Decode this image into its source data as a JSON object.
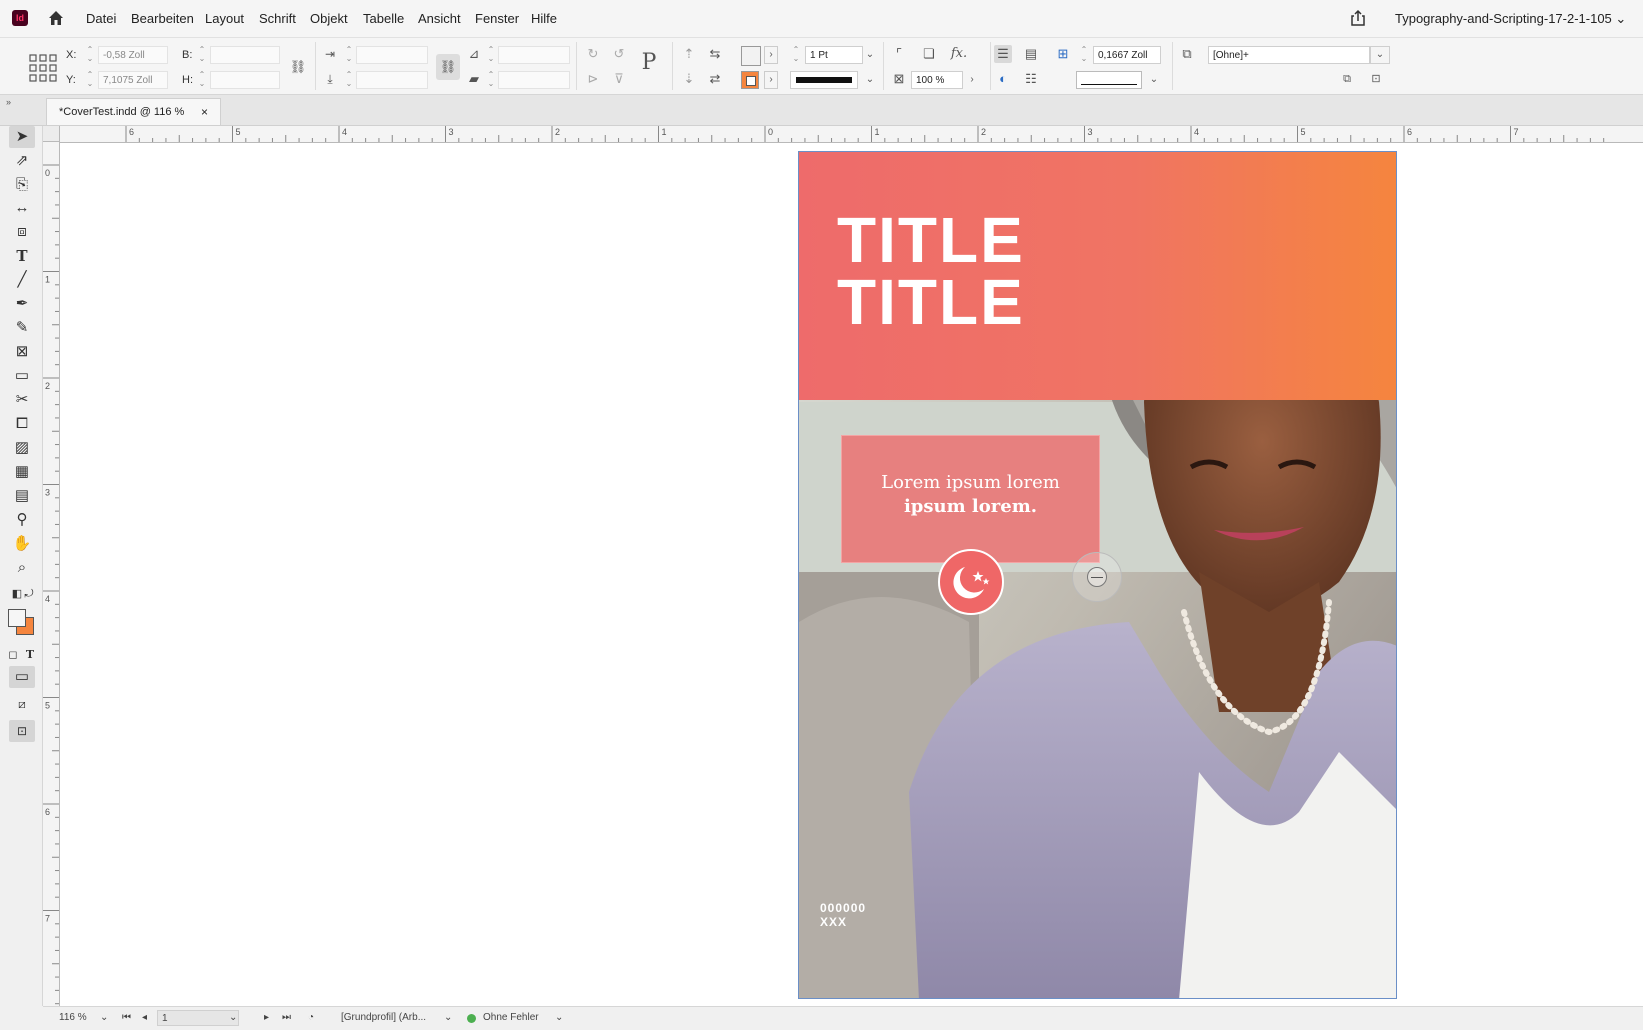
{
  "app": {
    "logo_text": "Id",
    "document_title": "Typography-and-Scripting-17-2-1-105"
  },
  "menu": [
    "Datei",
    "Bearbeiten",
    "Layout",
    "Schrift",
    "Objekt",
    "Tabelle",
    "Ansicht",
    "Fenster",
    "Hilfe"
  ],
  "control": {
    "x_label": "X:",
    "x_value": "-0,58 Zoll",
    "y_label": "Y:",
    "y_value": "7,1075 Zoll",
    "w_label": "B:",
    "h_label": "H:",
    "stroke_weight": "1 Pt",
    "opacity": "100 %",
    "gap": "0,1667 Zoll",
    "object_style": "[Ohne]+"
  },
  "tab": {
    "label": "*CoverTest.indd @ 116 %",
    "close": "×"
  },
  "ruler": {
    "top_labels": [
      "6",
      "5",
      "4",
      "3",
      "2",
      "1",
      "0",
      "1",
      "2",
      "3",
      "4",
      "5",
      "6",
      "7"
    ],
    "left_labels": [
      "0",
      "1",
      "2",
      "3",
      "4",
      "5",
      "6",
      "7"
    ]
  },
  "page": {
    "title_line1": "TITLE",
    "title_line2": "TITLE",
    "body_line1": "Lorem ipsum lorem",
    "body_line2": "ipsum lorem.",
    "code_line1": "000000",
    "code_line2": "XXX"
  },
  "status": {
    "zoom": "116 %",
    "page": "1",
    "profile": "[Grundprofil] (Arb...",
    "preflight": "Ohne Fehler"
  },
  "colors": {
    "accent_coral": "#ef6b6b",
    "accent_orange": "#f5853e",
    "selection_blue": "#6b8fc7",
    "preflight_ok": "#4caf50"
  }
}
